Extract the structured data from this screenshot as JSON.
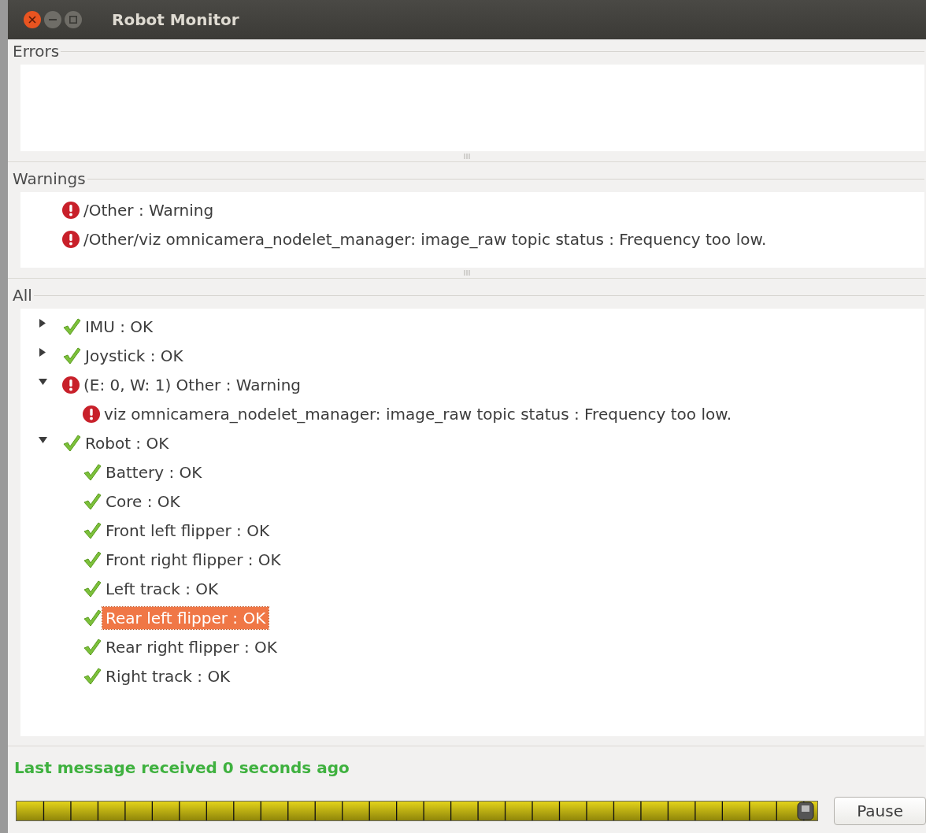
{
  "window": {
    "title": "Robot Monitor"
  },
  "errors": {
    "title": "Errors"
  },
  "warnings": {
    "title": "Warnings",
    "items": [
      {
        "kind": "error",
        "label": "/Other : Warning"
      },
      {
        "kind": "error",
        "label": "/Other/viz omnicamera_nodelet_manager: image_raw topic status : Frequency too low."
      }
    ]
  },
  "all": {
    "title": "All",
    "items": [
      {
        "kind": "ok",
        "label": "IMU : OK",
        "expanded": false,
        "selected": false
      },
      {
        "kind": "ok",
        "label": "Joystick : OK",
        "expanded": false,
        "selected": false
      },
      {
        "kind": "error",
        "label": "(E: 0, W: 1) Other : Warning",
        "expanded": true,
        "selected": false,
        "children": [
          {
            "kind": "error",
            "label": "viz omnicamera_nodelet_manager: image_raw topic status : Frequency too low.",
            "selected": false
          }
        ]
      },
      {
        "kind": "ok",
        "label": "Robot : OK",
        "expanded": true,
        "selected": false,
        "children": [
          {
            "kind": "ok",
            "label": "Battery : OK",
            "selected": false
          },
          {
            "kind": "ok",
            "label": "Core : OK",
            "selected": false
          },
          {
            "kind": "ok",
            "label": "Front left flipper : OK",
            "selected": false
          },
          {
            "kind": "ok",
            "label": "Front right flipper : OK",
            "selected": false
          },
          {
            "kind": "ok",
            "label": "Left track : OK",
            "selected": false
          },
          {
            "kind": "ok",
            "label": "Rear left flipper : OK",
            "selected": true
          },
          {
            "kind": "ok",
            "label": "Rear right flipper : OK",
            "selected": false
          },
          {
            "kind": "ok",
            "label": "Right track : OK",
            "selected": false
          }
        ]
      }
    ]
  },
  "status_bar": {
    "text": "Last message received 0 seconds ago"
  },
  "timeline": {
    "level": 0.985
  },
  "buttons": [
    {
      "label": "Pause"
    }
  ]
}
